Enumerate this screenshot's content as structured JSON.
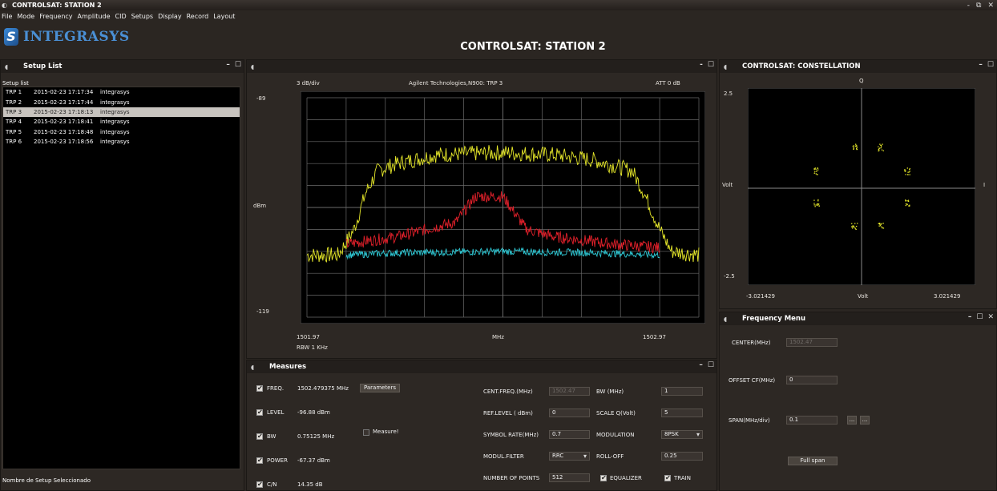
{
  "window": {
    "title": "CONTROLSAT: STATION 2",
    "controls": [
      "-",
      "⧉",
      "✕"
    ]
  },
  "menu": [
    "File",
    "Mode",
    "Frequency",
    "Amplitude",
    "CID",
    "Setups",
    "Display",
    "Record",
    "Layout"
  ],
  "logo": {
    "mark": "S",
    "text": "INTEGRASYS"
  },
  "main_title": "CONTROLSAT: STATION 2",
  "setup_panel": {
    "title": "Setup List",
    "list_label": "Setup list",
    "rows": [
      {
        "name": "TRP 1",
        "date": "2015-02-23 17:17:34",
        "user": "integrasys",
        "selected": false
      },
      {
        "name": "TRP 2",
        "date": "2015-02-23 17:17:44",
        "user": "integrasys",
        "selected": false
      },
      {
        "name": "TRP 3",
        "date": "2015-02-23 17:18:13",
        "user": "integrasys",
        "selected": true
      },
      {
        "name": "TRP 4",
        "date": "2015-02-23 17:18:41",
        "user": "integrasys",
        "selected": false
      },
      {
        "name": "TRP 5",
        "date": "2015-02-23 17:18:48",
        "user": "integrasys",
        "selected": false
      },
      {
        "name": "TRP 6",
        "date": "2015-02-23 17:18:56",
        "user": "integrasys",
        "selected": false
      }
    ],
    "selected_label": "Nombre de Setup Seleccionado"
  },
  "spectrum": {
    "scale": "3 dB/div",
    "instrument": "Agilent Technologies,N900: TRP 3",
    "att": "ATT 0 dB",
    "y_top": "-89",
    "y_unit": "dBm",
    "y_bottom": "-119",
    "x_left": "1501.97",
    "x_unit": "MHz",
    "x_right": "1502.97",
    "rbw": "RBW 1 KHz",
    "colors": {
      "trace1": "#e6e82a",
      "trace2": "#e0202a",
      "trace3": "#2ec6d2",
      "grid": "#6a6a6a",
      "bg": "#000000"
    }
  },
  "chart_data": [
    {
      "type": "line",
      "xlim": [
        1501.97,
        1502.97
      ],
      "ylim": [
        -119,
        -89
      ],
      "series": [
        {
          "x": [
            1501.97,
            1502.05,
            1502.09,
            1502.12,
            1502.15,
            1502.2,
            1502.3,
            1502.47,
            1502.6,
            1502.7,
            1502.8,
            1502.83,
            1502.87,
            1502.9,
            1502.97
          ],
          "y": [
            -110.5,
            -110.5,
            -107,
            -102,
            -99,
            -98,
            -96.8,
            -96.5,
            -96.8,
            -97.5,
            -99,
            -102,
            -107,
            -110,
            -110.5
          ]
        },
        {
          "x": [
            1502.07,
            1502.2,
            1502.35,
            1502.4,
            1502.47,
            1502.53,
            1502.6,
            1502.75,
            1502.87
          ],
          "y": [
            -109,
            -108,
            -106,
            -102.5,
            -102.5,
            -107,
            -108,
            -109,
            -109.5
          ]
        },
        {
          "x": [
            1502.07,
            1502.2,
            1502.47,
            1502.7,
            1502.87
          ],
          "y": [
            -110.5,
            -110.2,
            -110,
            -110.2,
            -110.5
          ]
        }
      ]
    },
    {
      "type": "scatter",
      "xlim": [
        -3.021429,
        3.021429
      ],
      "ylim": [
        -2.5,
        2.5
      ],
      "xlabel": "Volt",
      "ylabel": "Volt",
      "series": [
        {
          "x": [
            -0.2,
            0.5,
            1.2,
            1.2,
            0.5,
            -0.2,
            -1.2,
            -1.2
          ],
          "y": [
            1.0,
            1.0,
            0.4,
            -0.4,
            -1.0,
            -1.0,
            -0.4,
            0.4
          ]
        }
      ]
    }
  ],
  "spectrum_panel": {
    "controls": [
      "-",
      "☐"
    ]
  },
  "constellation_panel": {
    "title": "CONTROLSAT: CONSTELLATION",
    "q": "Q",
    "i": "I",
    "y_top": "2.5",
    "y_unit": "Volt",
    "y_bottom": "-2.5",
    "x_left": "-3.021429",
    "x_unit": "Volt",
    "x_right": "3.021429"
  },
  "measures": {
    "title": "Measures",
    "freq_label": "FREQ.",
    "freq_value": "1502.479375 MHz",
    "level_label": "LEVEL",
    "level_value": "-96.88 dBm",
    "bw_label": "BW",
    "bw_value": "0.75125 MHz",
    "power_label": "POWER",
    "power_value": "-67.37 dBm",
    "cn_label": "C/N",
    "cn_value": "14.35 dB",
    "parameters_button": "Parameters",
    "measure_label": "Measure!",
    "cent_freq_label": "CENT.FREQ.(MHz)",
    "cent_freq_value": "1502.47",
    "ref_level_label": "REF.LEVEL ( dBm)",
    "ref_level_value": "0",
    "symbol_rate_label": "SYMBOL RATE(MHz)",
    "symbol_rate_value": "0.7",
    "modul_filter_label": "MODUL.FILTER",
    "modul_filter_value": "RRC",
    "num_points_label": "NUMBER OF POINTS",
    "num_points_value": "512",
    "bw_mhz_label": "BW (MHz)",
    "bw_mhz_value": "1",
    "scale_q_label": "SCALE Q(Volt)",
    "scale_q_value": "5",
    "modulation_label": "MODULATION",
    "modulation_value": "8PSK",
    "roll_off_label": "ROLL-OFF",
    "roll_off_value": "0.25",
    "equalizer_label": "EQUALIZER",
    "train_label": "TRAIN"
  },
  "frequency_menu": {
    "title": "Frequency Menu",
    "center_label": "CENTER(MHz)",
    "center_value": "1502.47",
    "offset_label": "OFFSET CF(MHz)",
    "offset_value": "0",
    "span_label": "SPAN(MHz/div)",
    "span_value": "0.1",
    "span_btn1": "...",
    "span_btn2": "...",
    "full_span": "Full span"
  }
}
